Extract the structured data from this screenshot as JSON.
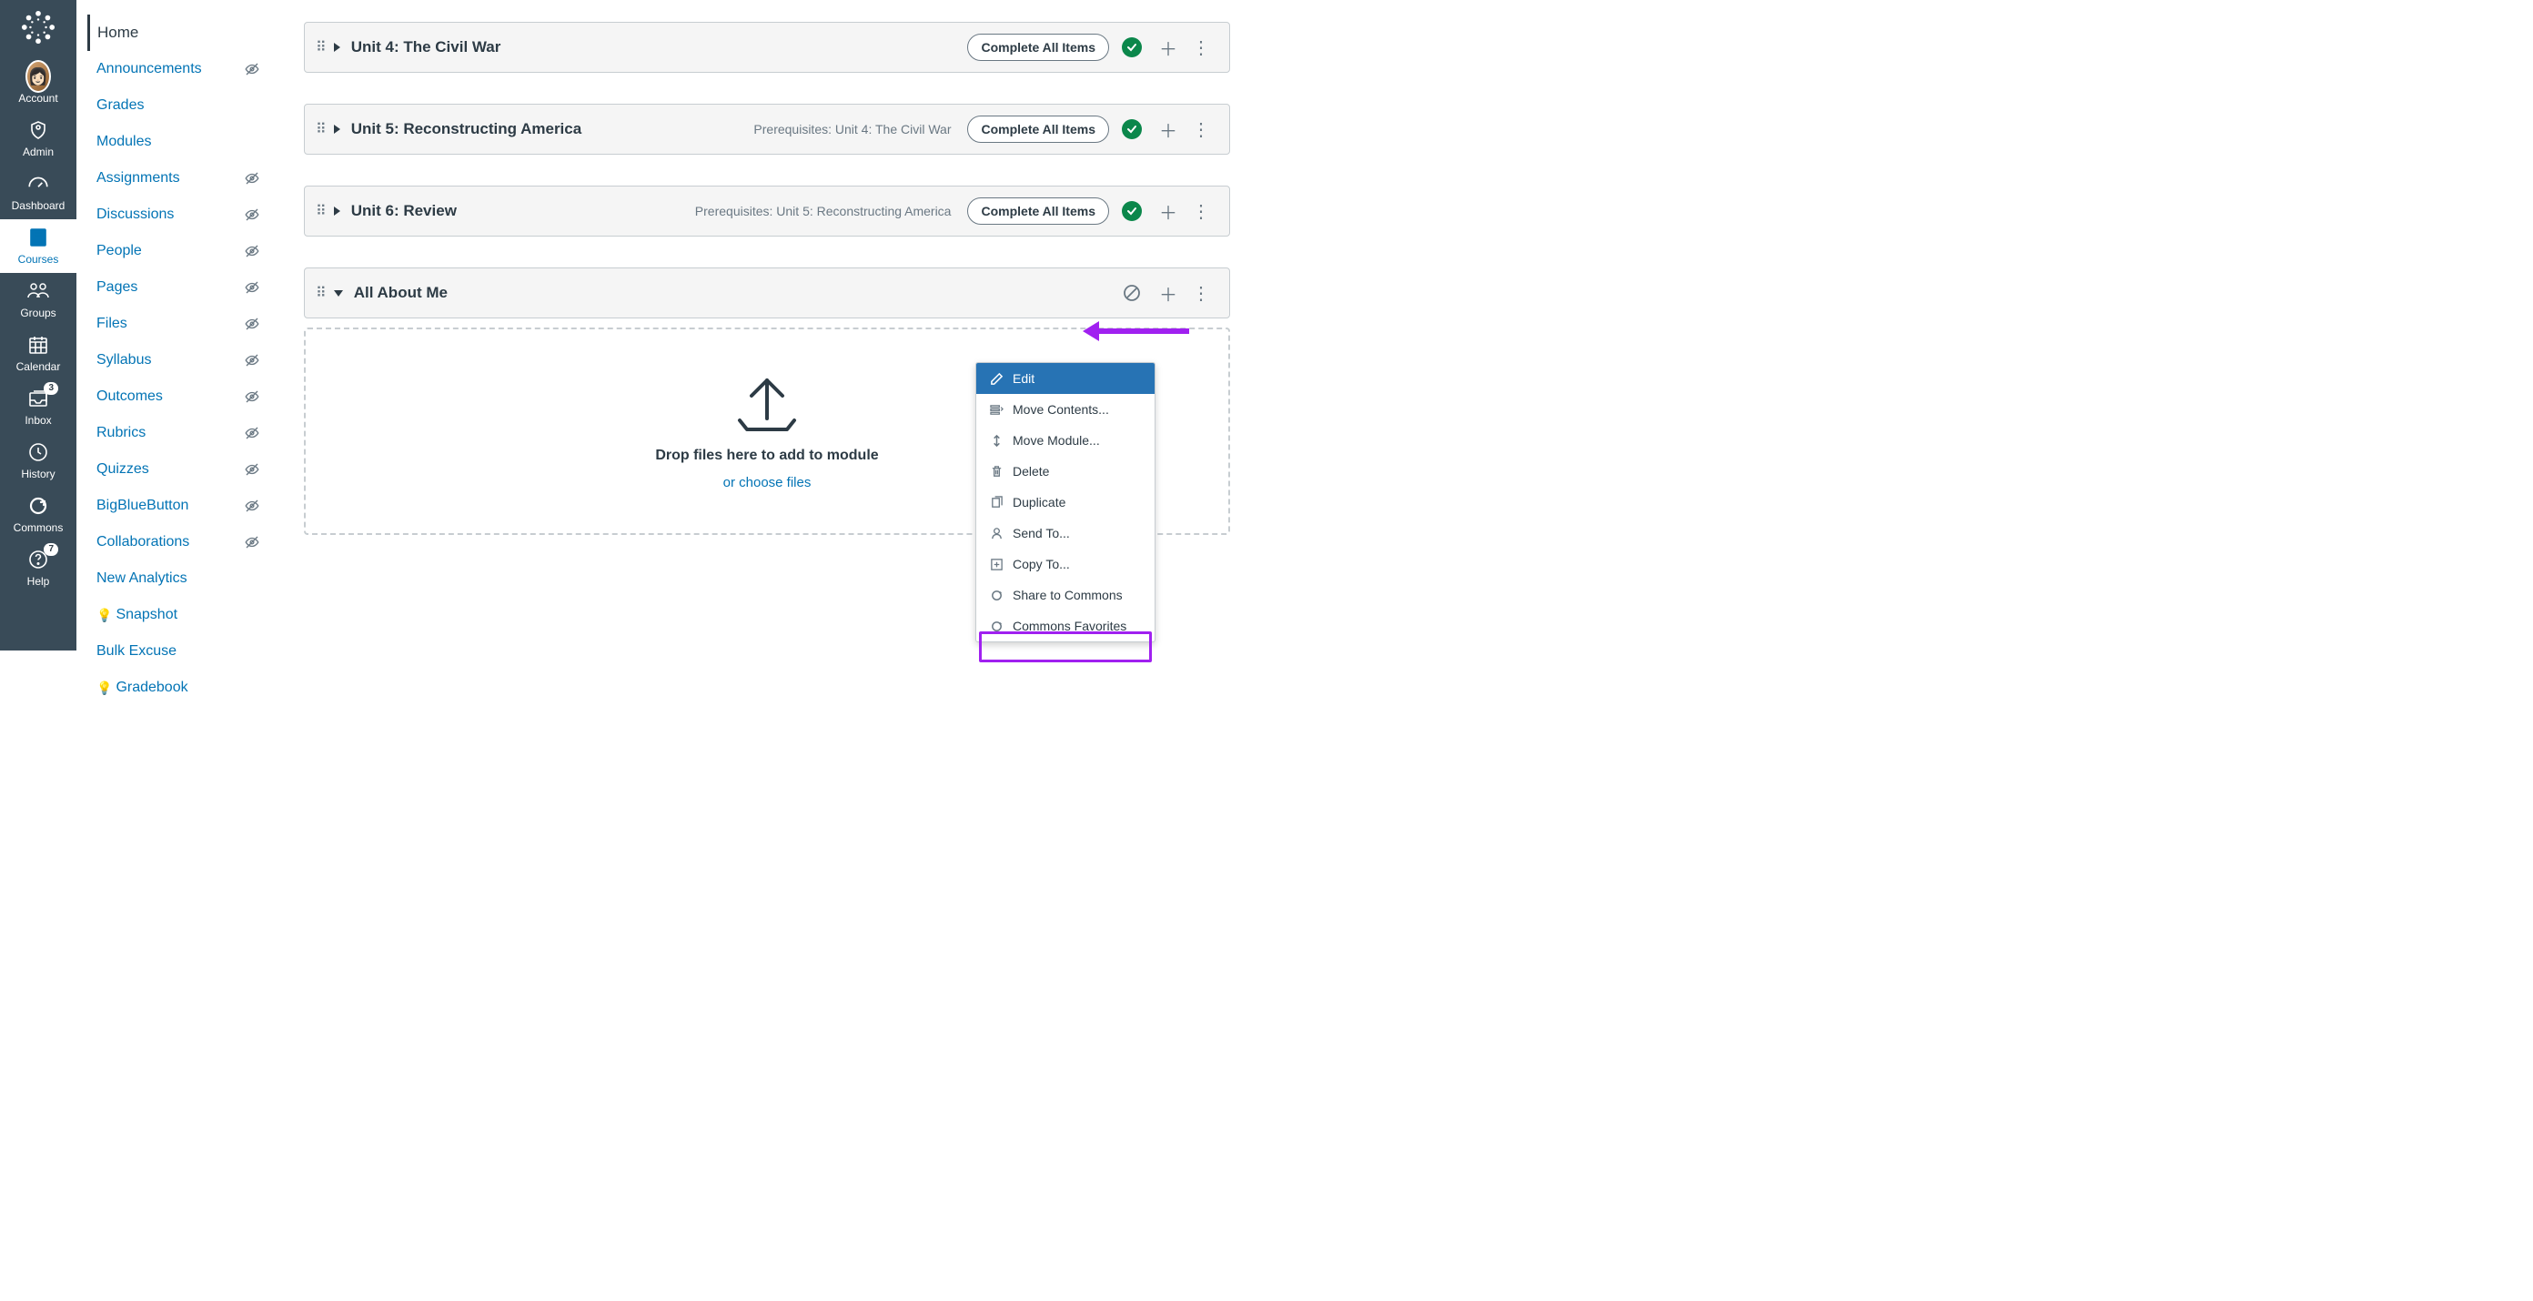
{
  "global_nav": {
    "items": [
      {
        "label": "Account"
      },
      {
        "label": "Admin"
      },
      {
        "label": "Dashboard"
      },
      {
        "label": "Courses"
      },
      {
        "label": "Groups"
      },
      {
        "label": "Calendar"
      },
      {
        "label": "Inbox",
        "badge": "3"
      },
      {
        "label": "History"
      },
      {
        "label": "Commons"
      },
      {
        "label": "Help",
        "badge": "7"
      }
    ]
  },
  "course_nav": {
    "items": [
      {
        "label": "Home",
        "active": true
      },
      {
        "label": "Announcements",
        "hidden": true
      },
      {
        "label": "Grades"
      },
      {
        "label": "Modules"
      },
      {
        "label": "Assignments",
        "hidden": true
      },
      {
        "label": "Discussions",
        "hidden": true
      },
      {
        "label": "People",
        "hidden": true
      },
      {
        "label": "Pages",
        "hidden": true
      },
      {
        "label": "Files",
        "hidden": true
      },
      {
        "label": "Syllabus",
        "hidden": true
      },
      {
        "label": "Outcomes",
        "hidden": true
      },
      {
        "label": "Rubrics",
        "hidden": true
      },
      {
        "label": "Quizzes",
        "hidden": true
      },
      {
        "label": "BigBlueButton",
        "hidden": true
      },
      {
        "label": "Collaborations",
        "hidden": true
      },
      {
        "label": "New Analytics"
      },
      {
        "label": "Snapshot",
        "bulb": true
      },
      {
        "label": "Bulk Excuse"
      },
      {
        "label": "Gradebook",
        "bulb": true
      }
    ]
  },
  "modules": [
    {
      "title": "Unit 4: The Civil War",
      "pill": "Complete All Items",
      "prereq": "",
      "published": true,
      "expanded": false
    },
    {
      "title": "Unit 5: Reconstructing America",
      "pill": "Complete All Items",
      "prereq": "Prerequisites: Unit 4: The Civil War",
      "published": true,
      "expanded": false
    },
    {
      "title": "Unit 6: Review",
      "pill": "Complete All Items",
      "prereq": "Prerequisites: Unit 5: Reconstructing America",
      "published": true,
      "expanded": false
    },
    {
      "title": "All About Me",
      "pill": "",
      "prereq": "",
      "published": false,
      "expanded": true
    }
  ],
  "dropzone": {
    "text": "Drop files here to add to module",
    "link": "or choose files"
  },
  "menu": {
    "items": [
      {
        "label": "Edit"
      },
      {
        "label": "Move Contents..."
      },
      {
        "label": "Move Module..."
      },
      {
        "label": "Delete"
      },
      {
        "label": "Duplicate"
      },
      {
        "label": "Send To..."
      },
      {
        "label": "Copy To..."
      },
      {
        "label": "Share to Commons"
      },
      {
        "label": "Commons Favorites"
      }
    ]
  },
  "colors": {
    "link": "#0374B5",
    "accent": "#A020F0",
    "publish_green": "#0B874B"
  }
}
